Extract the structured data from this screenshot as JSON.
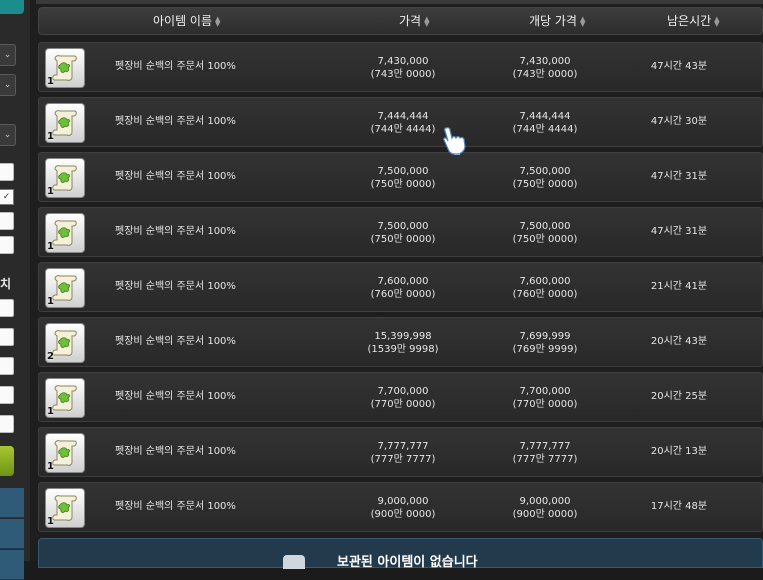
{
  "left_panel": {
    "dropdown_glyph": "⌄",
    "checkbox_mark": "✓",
    "heading_partial": "치"
  },
  "table": {
    "columns": {
      "name": "아이템 이름",
      "price": "가격",
      "unit_price": "개당 가격",
      "time_left": "남은시간"
    },
    "sort_glyph_up": "▲",
    "sort_glyph_down": "▼",
    "rows": [
      {
        "qty": "1",
        "name": "펫장비 순백의 주문서 100%",
        "price": "7,430,000",
        "price_kr": "(743만 0000)",
        "unit_price": "7,430,000",
        "unit_price_kr": "(743만 0000)",
        "time_left": "47시간 43분"
      },
      {
        "qty": "1",
        "name": "펫장비 순백의 주문서 100%",
        "price": "7,444,444",
        "price_kr": "(744만 4444)",
        "unit_price": "7,444,444",
        "unit_price_kr": "(744만 4444)",
        "time_left": "47시간 30분"
      },
      {
        "qty": "1",
        "name": "펫장비 순백의 주문서 100%",
        "price": "7,500,000",
        "price_kr": "(750만 0000)",
        "unit_price": "7,500,000",
        "unit_price_kr": "(750만 0000)",
        "time_left": "47시간 31분"
      },
      {
        "qty": "1",
        "name": "펫장비 순백의 주문서 100%",
        "price": "7,500,000",
        "price_kr": "(750만 0000)",
        "unit_price": "7,500,000",
        "unit_price_kr": "(750만 0000)",
        "time_left": "47시간 31분"
      },
      {
        "qty": "1",
        "name": "펫장비 순백의 주문서 100%",
        "price": "7,600,000",
        "price_kr": "(760만 0000)",
        "unit_price": "7,600,000",
        "unit_price_kr": "(760만 0000)",
        "time_left": "21시간 41분"
      },
      {
        "qty": "2",
        "name": "펫장비 순백의 주문서 100%",
        "price": "15,399,998",
        "price_kr": "(1539만 9998)",
        "unit_price": "7,699,999",
        "unit_price_kr": "(769만 9999)",
        "time_left": "20시간 43분"
      },
      {
        "qty": "1",
        "name": "펫장비 순백의 주문서 100%",
        "price": "7,700,000",
        "price_kr": "(770만 0000)",
        "unit_price": "7,700,000",
        "unit_price_kr": "(770만 0000)",
        "time_left": "20시간 25분"
      },
      {
        "qty": "1",
        "name": "펫장비 순백의 주문서 100%",
        "price": "7,777,777",
        "price_kr": "(777만 7777)",
        "unit_price": "7,777,777",
        "unit_price_kr": "(777만 7777)",
        "time_left": "20시간 13분"
      },
      {
        "qty": "1",
        "name": "펫장비 순백의 주문서 100%",
        "price": "9,000,000",
        "price_kr": "(900만 0000)",
        "unit_price": "9,000,000",
        "unit_price_kr": "(900만 0000)",
        "time_left": "17시간 48분"
      }
    ]
  },
  "footer": {
    "text": "보관된 아이템이 없습니다"
  },
  "colors": {
    "accent_teal": "#1c8c8c",
    "button_green": "#8fb322",
    "footer_blue": "#223a4c"
  }
}
